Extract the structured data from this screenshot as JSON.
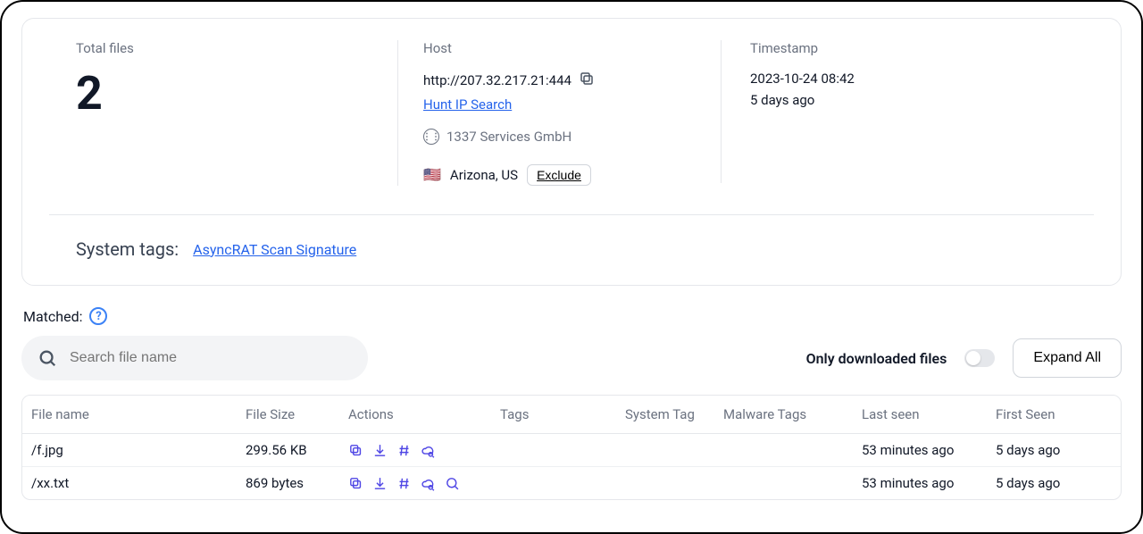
{
  "summary": {
    "total_files_label": "Total files",
    "total_files_value": "2",
    "host_label": "Host",
    "host_url": "http://207.32.217.21:444",
    "hunt_ip_link": "Hunt IP Search",
    "asn_org": "1337 Services GmbH",
    "location": "Arizona, US",
    "exclude_label": "Exclude",
    "timestamp_label": "Timestamp",
    "timestamp_value": "2023-10-24 08:42",
    "timestamp_relative": "5 days ago"
  },
  "systags": {
    "label": "System tags:",
    "items": [
      "AsyncRAT Scan Signature"
    ]
  },
  "matched_label": "Matched:",
  "search_placeholder": "Search file name",
  "only_downloaded_label": "Only downloaded files",
  "expand_all_label": "Expand All",
  "table": {
    "headers": {
      "file_name": "File name",
      "file_size": "File Size",
      "actions": "Actions",
      "tags": "Tags",
      "system_tag": "System Tag",
      "malware_tags": "Malware Tags",
      "last_seen": "Last seen",
      "first_seen": "First Seen"
    },
    "rows": [
      {
        "file_name": "/f.jpg",
        "file_size": "299.56 KB",
        "tags": "",
        "system_tag": "",
        "malware_tags": "",
        "last_seen": "53 minutes ago",
        "first_seen": "5 days ago",
        "has_search_action": false
      },
      {
        "file_name": "/xx.txt",
        "file_size": "869 bytes",
        "tags": "",
        "system_tag": "",
        "malware_tags": "",
        "last_seen": "53 minutes ago",
        "first_seen": "5 days ago",
        "has_search_action": true
      }
    ]
  }
}
